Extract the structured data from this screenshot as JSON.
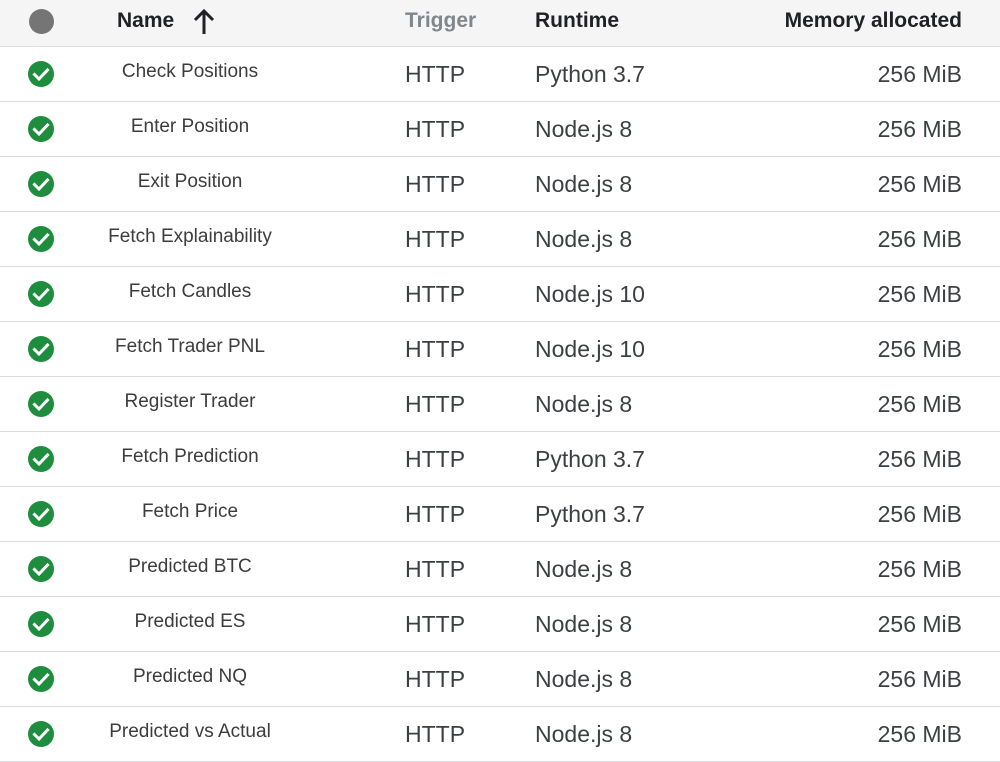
{
  "header": {
    "name": "Name",
    "trigger": "Trigger",
    "runtime": "Runtime",
    "memory": "Memory allocated",
    "sort_icon": "arrow-up-icon",
    "status_icon": "status-dot-icon"
  },
  "colors": {
    "status_ok": "#1e8e3e",
    "header_status": "#757575",
    "header_bg": "#f5f5f5"
  },
  "rows": [
    {
      "name": "Check Positions",
      "trigger": "HTTP",
      "runtime": "Python 3.7",
      "memory": "256 MiB",
      "status": "check-circle-icon"
    },
    {
      "name": "Enter Position",
      "trigger": "HTTP",
      "runtime": "Node.js 8",
      "memory": "256 MiB",
      "status": "check-circle-icon"
    },
    {
      "name": "Exit Position",
      "trigger": "HTTP",
      "runtime": "Node.js 8",
      "memory": "256 MiB",
      "status": "check-circle-icon"
    },
    {
      "name": "Fetch Explainability",
      "trigger": "HTTP",
      "runtime": "Node.js 8",
      "memory": "256 MiB",
      "status": "check-circle-icon"
    },
    {
      "name": "Fetch Candles",
      "trigger": "HTTP",
      "runtime": "Node.js 10",
      "memory": "256 MiB",
      "status": "check-circle-icon"
    },
    {
      "name": "Fetch Trader PNL",
      "trigger": "HTTP",
      "runtime": "Node.js 10",
      "memory": "256 MiB",
      "status": "check-circle-icon"
    },
    {
      "name": "Register Trader",
      "trigger": "HTTP",
      "runtime": "Node.js 8",
      "memory": "256 MiB",
      "status": "check-circle-icon"
    },
    {
      "name": "Fetch Prediction",
      "trigger": "HTTP",
      "runtime": "Python 3.7",
      "memory": "256 MiB",
      "status": "check-circle-icon"
    },
    {
      "name": "Fetch Price",
      "trigger": "HTTP",
      "runtime": "Python 3.7",
      "memory": "256 MiB",
      "status": "check-circle-icon"
    },
    {
      "name": "Predicted BTC",
      "trigger": "HTTP",
      "runtime": "Node.js 8",
      "memory": "256 MiB",
      "status": "check-circle-icon"
    },
    {
      "name": "Predicted ES",
      "trigger": "HTTP",
      "runtime": "Node.js 8",
      "memory": "256 MiB",
      "status": "check-circle-icon"
    },
    {
      "name": "Predicted NQ",
      "trigger": "HTTP",
      "runtime": "Node.js 8",
      "memory": "256 MiB",
      "status": "check-circle-icon"
    },
    {
      "name": "Predicted vs Actual",
      "trigger": "HTTP",
      "runtime": "Node.js 8",
      "memory": "256 MiB",
      "status": "check-circle-icon"
    }
  ]
}
